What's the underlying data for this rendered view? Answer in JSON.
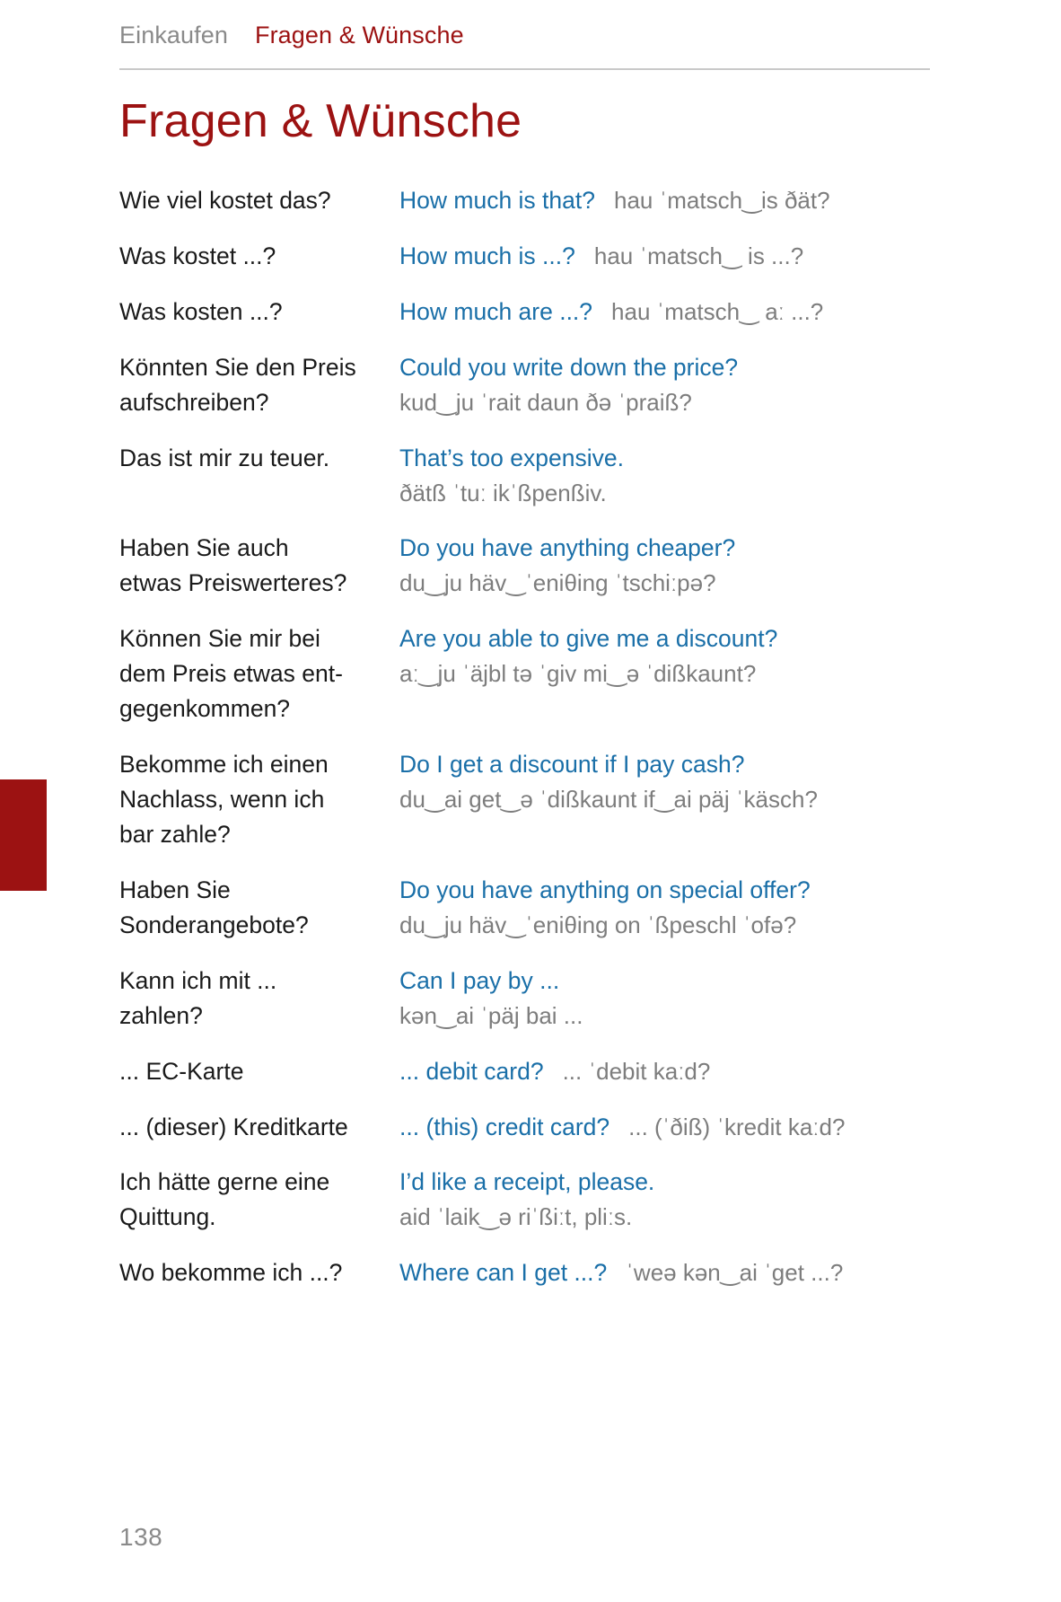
{
  "running_head": {
    "section": "Einkaufen",
    "chapter": "Fragen & Wünsche"
  },
  "page_title": "Fragen & Wünsche",
  "folio": "138",
  "colors": {
    "accent_red": "#9c1212",
    "english_blue": "#1a6fa8",
    "pronunciation_gray": "#7d7d7d",
    "german_black": "#1a1a1a",
    "rule_gray": "#c9c9c9"
  },
  "entries": [
    {
      "layout": "inline",
      "de": [
        "Wie viel kostet das?"
      ],
      "en": "How much is that?",
      "pron": "hau ˈmatsch‿is ðät?"
    },
    {
      "layout": "inline",
      "de": [
        "Was kostet ...?"
      ],
      "en": "How much is ...?",
      "pron": "hau ˈmatsch‿ is ...?"
    },
    {
      "layout": "inline",
      "de": [
        "Was kosten ...?"
      ],
      "en": "How much are ...?",
      "pron": "hau ˈmatsch‿ aː ...?"
    },
    {
      "layout": "stacked",
      "de": [
        "Könnten Sie den Preis",
        "aufschreiben?"
      ],
      "en": "Could you write down the price?",
      "pron": "kud‿ju ˈrait daun ðə ˈpraiß?"
    },
    {
      "layout": "stacked",
      "de": [
        "Das ist mir zu teuer."
      ],
      "en": "That’s too expensive.",
      "pron": "ðätß ˈtuː ikˈßpenßiv."
    },
    {
      "layout": "stacked",
      "de": [
        "Haben Sie auch",
        "etwas Preiswerteres?"
      ],
      "en": "Do you have anything cheaper?",
      "pron": "du‿ju häv‿ˈeniθing ˈtschiːpə?"
    },
    {
      "layout": "stacked",
      "de": [
        "Können Sie mir bei",
        "dem Preis etwas ent-",
        "gegenkommen?"
      ],
      "en": "Are you able to give me a discount?",
      "pron": "aː‿ju ˈäjbl tə ˈgiv mi‿ə ˈdißkaunt?"
    },
    {
      "layout": "stacked",
      "de": [
        "Bekomme ich einen",
        "Nachlass, wenn ich",
        "bar zahle?"
      ],
      "en": "Do I get a discount if I pay cash?",
      "pron": "du‿ai get‿ə ˈdißkaunt if‿ai päj ˈkäsch?"
    },
    {
      "layout": "stacked",
      "de": [
        "Haben Sie",
        "Sonderangebote?"
      ],
      "en": "Do you have anything on special offer?",
      "pron": "du‿ju häv‿ˈeniθing on ˈßpeschl ˈofə?"
    },
    {
      "layout": "stacked",
      "de": [
        "Kann ich mit ...",
        "zahlen?"
      ],
      "en": "Can I pay by ...",
      "pron": "kən‿ai ˈpäj bai ..."
    },
    {
      "layout": "inline",
      "de": [
        "... EC-Karte"
      ],
      "en": "... debit card?",
      "pron": "... ˈdebit kaːd?"
    },
    {
      "layout": "inline",
      "de": [
        "... (dieser) Kreditkarte"
      ],
      "en": "... (this) credit card?",
      "pron": "... (ˈðiß) ˈkredit kaːd?"
    },
    {
      "layout": "stacked",
      "de": [
        "Ich hätte gerne eine",
        "Quittung."
      ],
      "en": "I’d like a receipt, please.",
      "pron": "aid ˈlaik‿ə riˈßiːt, pliːs."
    },
    {
      "layout": "inline",
      "de": [
        "Wo bekomme ich ...?"
      ],
      "en": "Where can I get ...?",
      "pron": "ˈweə kən‿ai ˈget ...?"
    }
  ]
}
